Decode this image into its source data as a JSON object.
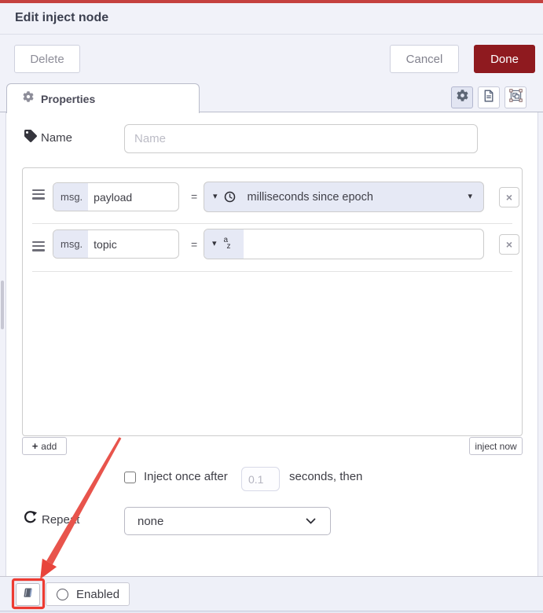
{
  "window": {
    "title": "Edit inject node"
  },
  "actions": {
    "delete": "Delete",
    "cancel": "Cancel",
    "done": "Done"
  },
  "tabs": {
    "properties": "Properties"
  },
  "name_field": {
    "label": "Name",
    "placeholder": "Name"
  },
  "props_list": {
    "rows": [
      {
        "prefix": "msg.",
        "key": "payload",
        "equals": "=",
        "type": "timestamp",
        "value_label": "milliseconds since epoch"
      },
      {
        "prefix": "msg.",
        "key": "topic",
        "equals": "=",
        "type": "string",
        "value_label": ""
      }
    ],
    "add_button": "add",
    "inject_now_button": "inject now"
  },
  "schedule": {
    "inject_once_label": "Inject once after",
    "delay_value": "0.1",
    "after_label": "seconds, then",
    "repeat_label": "Repeat",
    "repeat_selected": "none"
  },
  "footer": {
    "enabled_label": "Enabled"
  },
  "glyphs": {
    "caret_down": "▾",
    "remove": "×",
    "plus": "+",
    "string_a": "a",
    "string_z": "z"
  },
  "colors": {
    "top_line": "#c5413f",
    "done_red": "#8f1a1f",
    "field_lavender": "#e6e9f5",
    "panel_lavender": "#f1f2f9",
    "annotation_red": "#e8423a"
  }
}
